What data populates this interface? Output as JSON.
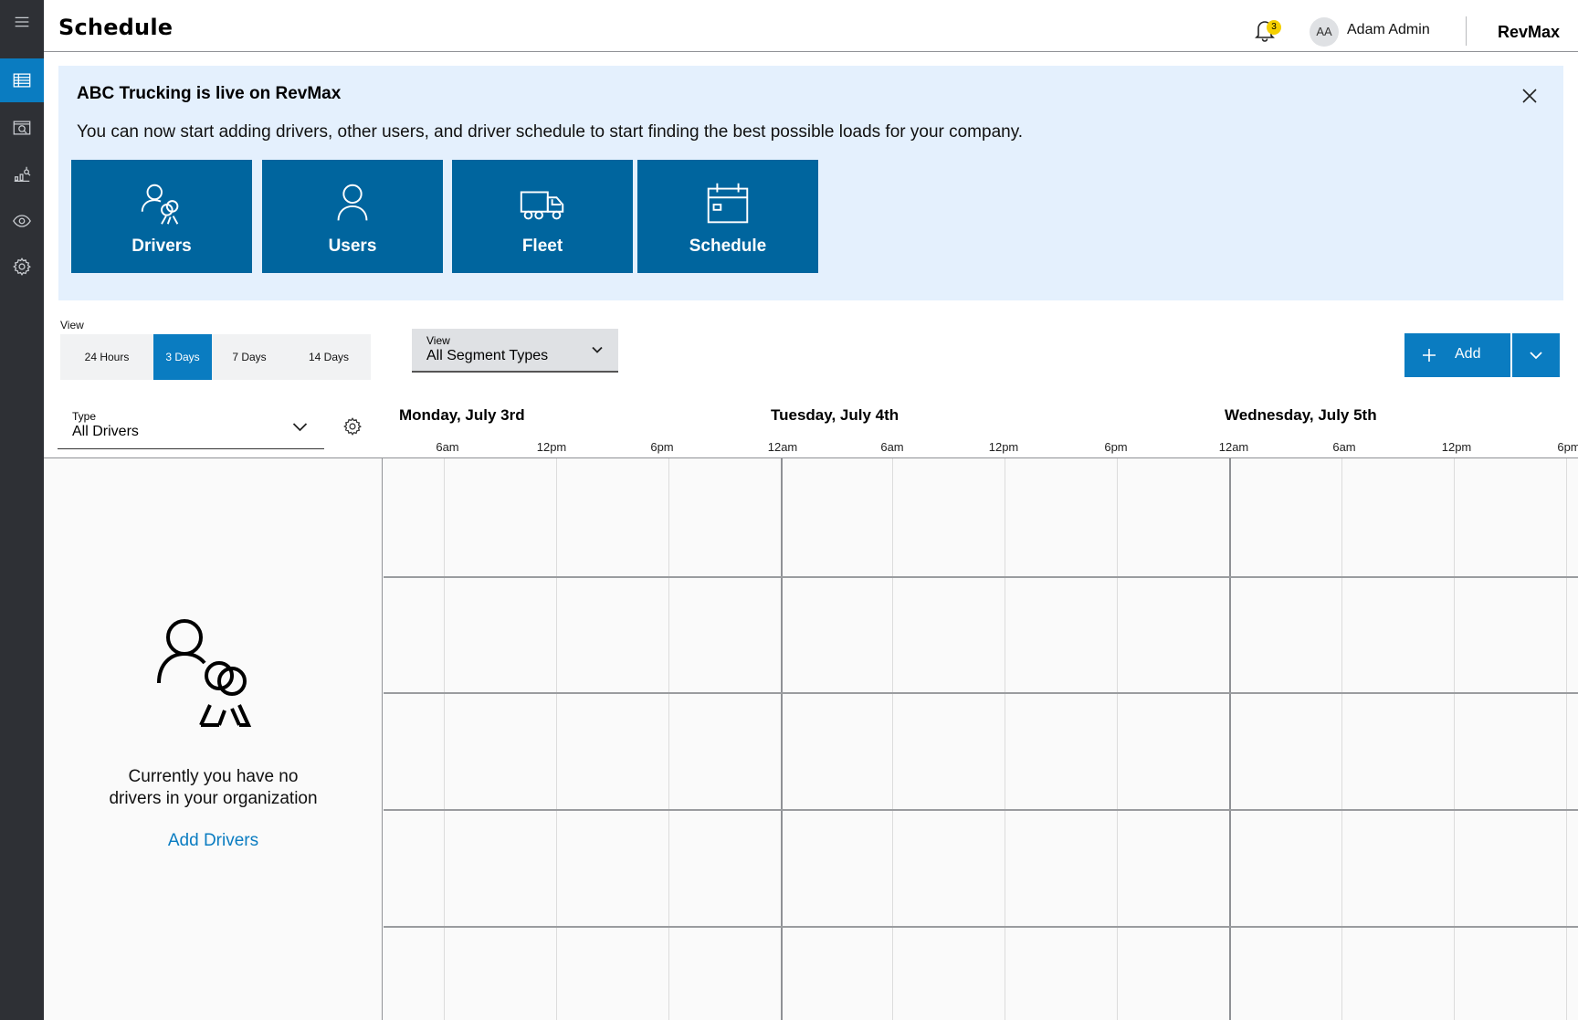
{
  "header": {
    "title": "Schedule",
    "notification_count": "3",
    "user_initials": "AA",
    "user_name": "Adam Admin",
    "brand": "RevMax"
  },
  "sidebar": {
    "items": [
      {
        "icon": "menu-icon"
      },
      {
        "icon": "table-icon",
        "active": true
      },
      {
        "icon": "search-window-icon"
      },
      {
        "icon": "analytics-icon"
      },
      {
        "icon": "eye-icon"
      },
      {
        "icon": "gear-icon"
      }
    ]
  },
  "banner": {
    "title": "ABC Trucking is live on RevMax",
    "text": "You can now start adding drivers, other users, and driver schedule to start finding the best possible loads for your company.",
    "tiles": [
      "Drivers",
      "Users",
      "Fleet",
      "Schedule"
    ]
  },
  "view_toggle": {
    "label": "View",
    "options": [
      "24 Hours",
      "3 Days",
      "7 Days",
      "14 Days"
    ],
    "selected": "3 Days"
  },
  "segment_dropdown": {
    "label": "View",
    "value": "All Segment Types"
  },
  "add_button": {
    "label": "Add"
  },
  "type_dropdown": {
    "label": "Type",
    "value": "All Drivers"
  },
  "timeline": {
    "days": [
      "Monday, July 3rd",
      "Tuesday, July 4th",
      "Wednesday, July 5th"
    ],
    "hours": [
      "6am",
      "12pm",
      "6pm",
      "12am",
      "6am",
      "12pm",
      "6pm",
      "12am",
      "6am",
      "12pm",
      "6pm"
    ]
  },
  "empty_state": {
    "line1": "Currently you have no",
    "line2": "drivers in your organization",
    "link": "Add Drivers"
  },
  "colors": {
    "primary": "#0a7cc1",
    "tile": "#00659e",
    "banner_bg": "#e4f0fd",
    "rail": "#2e3035",
    "badge": "#f5d000"
  }
}
